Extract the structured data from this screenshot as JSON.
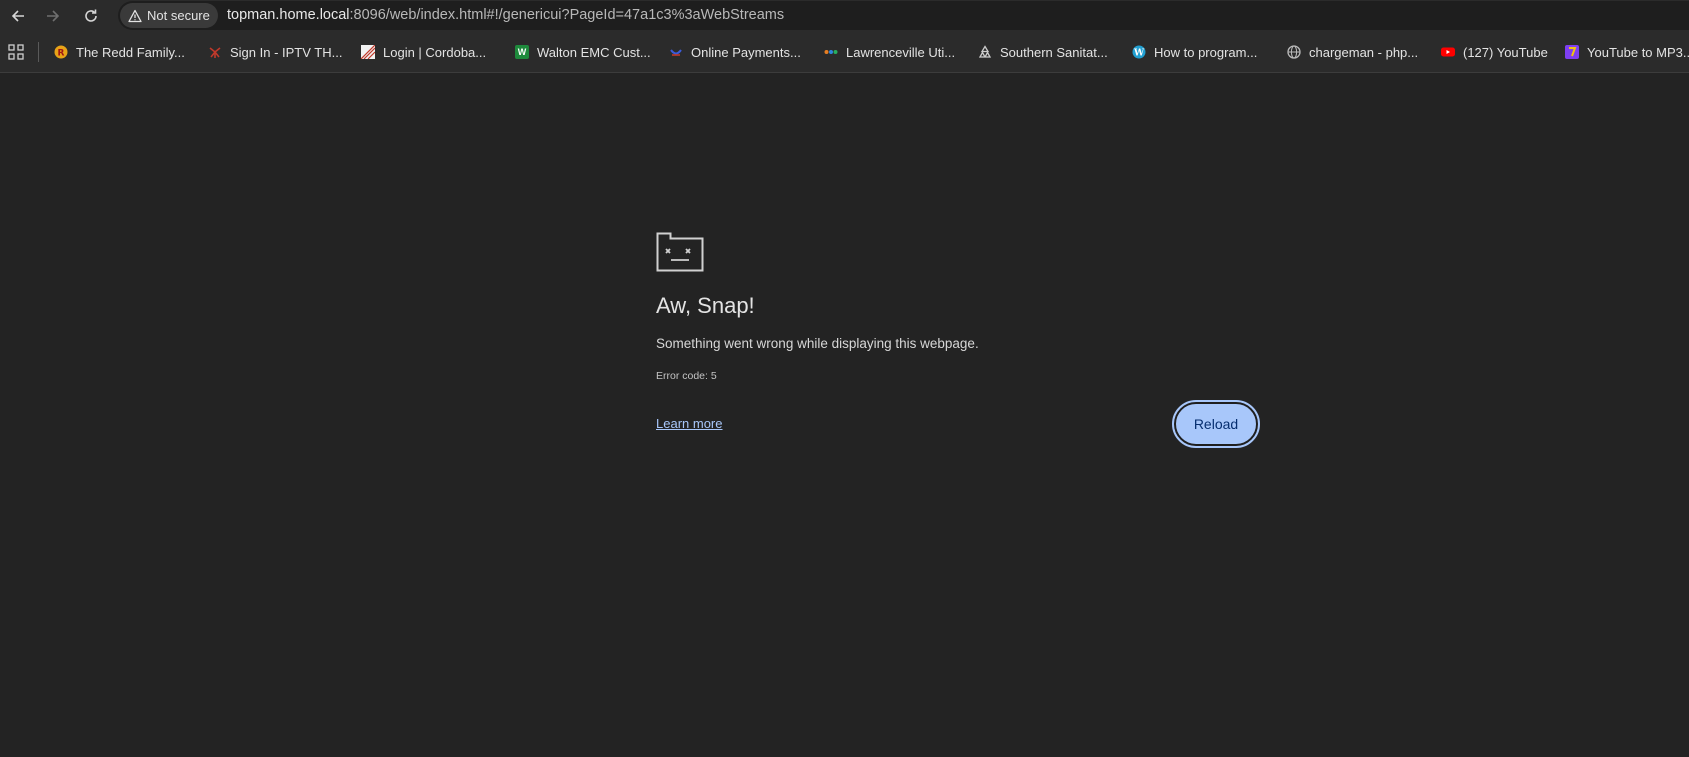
{
  "browser": {
    "security_label": "Not secure",
    "url_host": "topman.home.local",
    "url_rest": ":8096/web/index.html#!/genericui?PageId=47a1c3%3aWebStreams"
  },
  "bookmarks": [
    {
      "label": "The Redd Family...",
      "icon": "redd-family-favicon",
      "color": "#e8a317"
    },
    {
      "label": "Sign In - IPTV TH...",
      "icon": "iptv-favicon",
      "color": "#c0392b"
    },
    {
      "label": "Login | Cordoba...",
      "icon": "cordoba-favicon",
      "color": "#c0392b"
    },
    {
      "label": "Walton EMC Cust...",
      "icon": "walton-emc-favicon",
      "color": "#1e8a3c"
    },
    {
      "label": "Online Payments...",
      "icon": "online-payments-favicon",
      "color": "#3b5bdb"
    },
    {
      "label": "Lawrenceville Uti...",
      "icon": "lawrenceville-favicon",
      "color": "#e67e22"
    },
    {
      "label": "Southern Sanitat...",
      "icon": "recycle-favicon",
      "color": "#cccccc"
    },
    {
      "label": "How to program...",
      "icon": "wordpress-favicon",
      "color": "#21a0d2"
    },
    {
      "label": "chargeman - php...",
      "icon": "globe-favicon",
      "color": "#bbbbbb"
    },
    {
      "label": "(127) YouTube",
      "icon": "youtube-favicon",
      "color": "#ff0000"
    },
    {
      "label": "YouTube to MP3...",
      "icon": "yt-mp3-favicon",
      "color": "#7e3ff2"
    }
  ],
  "error": {
    "title": "Aw, Snap!",
    "message": "Something went wrong while displaying this webpage.",
    "code": "Error code: 5",
    "learn_more": "Learn more",
    "reload": "Reload"
  },
  "colors": {
    "page_bg": "#232323",
    "accent": "#a8c7fa",
    "button_text": "#062e6f"
  }
}
